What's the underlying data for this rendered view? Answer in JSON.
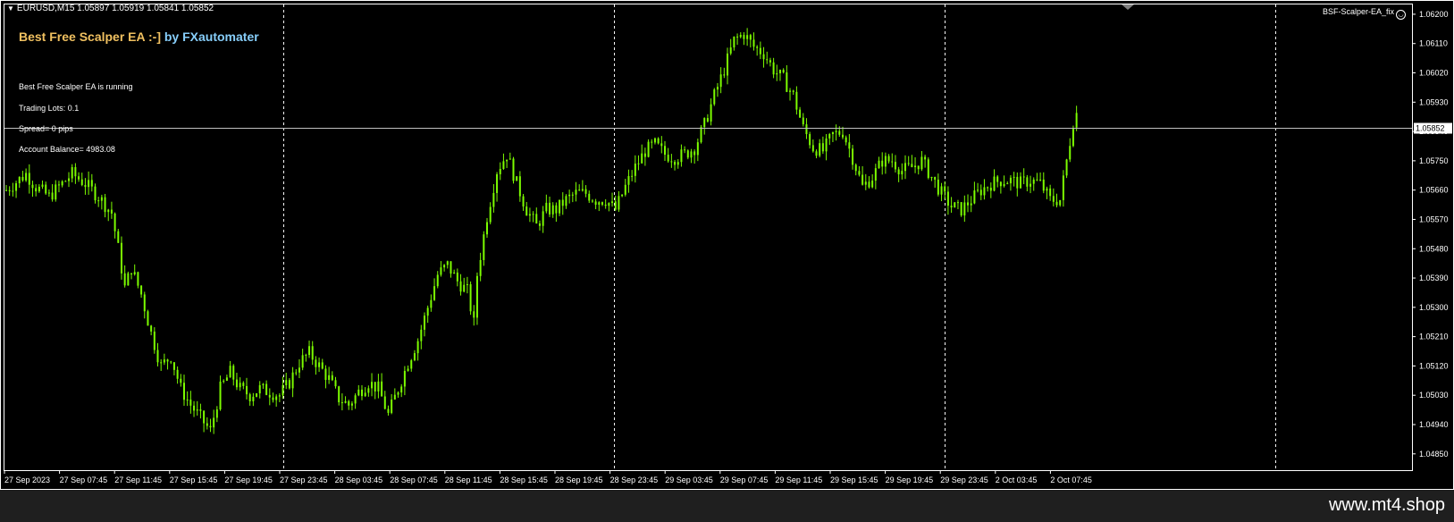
{
  "header": {
    "symbol_info": "EURUSD,M15  1.05897 1.05919 1.05841 1.05852",
    "ea_name": "BSF-Scalper-EA_fix"
  },
  "panel": {
    "title_part1": "Best Free Scalper EA :-]",
    "title_part2": " by FXautomater",
    "status": "Best Free Scalper EA is running",
    "lots": "Trading Lots:  0.1",
    "spread": "Spread= 0 pips",
    "balance": "Account Balance= 4983.08"
  },
  "footer": {
    "brand": "www.mt4.shop"
  },
  "colors": {
    "background": "#000000",
    "candle": "#7cfc00",
    "axis": "#ffffff",
    "grid": "#ffffff",
    "price_line": "#c0c0c0",
    "ea_title_a": "#f0c060",
    "ea_title_b": "#87cefa"
  },
  "chart_data": {
    "type": "candlestick",
    "symbol": "EURUSD",
    "timeframe": "M15",
    "ohlc_last": {
      "open": 1.05897,
      "high": 1.05919,
      "low": 1.05841,
      "close": 1.05852
    },
    "current_price": "1.05852",
    "ylim": [
      1.048,
      1.0623
    ],
    "y_ticks": [
      "1.06200",
      "1.06110",
      "1.06020",
      "1.05930",
      "1.05840",
      "1.05750",
      "1.05660",
      "1.05570",
      "1.05480",
      "1.05390",
      "1.05300",
      "1.05210",
      "1.05120",
      "1.05030",
      "1.04940",
      "1.04850"
    ],
    "x_ticks": [
      "27 Sep 2023",
      "27 Sep 07:45",
      "27 Sep 11:45",
      "27 Sep 15:45",
      "27 Sep 19:45",
      "27 Sep 23:45",
      "28 Sep 03:45",
      "28 Sep 07:45",
      "28 Sep 11:45",
      "28 Sep 15:45",
      "28 Sep 19:45",
      "28 Sep 23:45",
      "29 Sep 03:45",
      "29 Sep 07:45",
      "29 Sep 11:45",
      "29 Sep 15:45",
      "29 Sep 19:45",
      "29 Sep 23:45",
      "2 Oct 03:45",
      "2 Oct 07:45"
    ],
    "grid": "vertical day separators (dashed)",
    "close_path": [
      [
        0,
        1.0566
      ],
      [
        6,
        1.0571
      ],
      [
        9,
        1.0567
      ],
      [
        13,
        1.0564
      ],
      [
        17,
        1.0568
      ],
      [
        20,
        1.0571
      ],
      [
        24,
        1.0568
      ],
      [
        28,
        1.0564
      ],
      [
        32,
        1.0559
      ],
      [
        34,
        1.0548
      ],
      [
        36,
        1.0536
      ],
      [
        38,
        1.0542
      ],
      [
        41,
        1.0534
      ],
      [
        44,
        1.0522
      ],
      [
        47,
        1.0512
      ],
      [
        50,
        1.0515
      ],
      [
        53,
        1.0505
      ],
      [
        56,
        1.05
      ],
      [
        59,
        1.0496
      ],
      [
        62,
        1.0492
      ],
      [
        65,
        1.0505
      ],
      [
        68,
        1.051
      ],
      [
        71,
        1.0505
      ],
      [
        74,
        1.0503
      ],
      [
        77,
        1.0505
      ],
      [
        80,
        1.0504
      ],
      [
        83,
        1.0503
      ],
      [
        86,
        1.0507
      ],
      [
        89,
        1.0513
      ],
      [
        92,
        1.0516
      ],
      [
        95,
        1.0512
      ],
      [
        98,
        1.0508
      ],
      [
        101,
        1.0502
      ],
      [
        104,
        1.05
      ],
      [
        107,
        1.0504
      ],
      [
        110,
        1.0507
      ],
      [
        113,
        1.0505
      ],
      [
        116,
        1.0497
      ],
      [
        119,
        1.0505
      ],
      [
        122,
        1.0513
      ],
      [
        125,
        1.052
      ],
      [
        128,
        1.053
      ],
      [
        131,
        1.054
      ],
      [
        134,
        1.0543
      ],
      [
        137,
        1.0538
      ],
      [
        140,
        1.0535
      ],
      [
        142,
        1.0525
      ],
      [
        143,
        1.054
      ],
      [
        146,
        1.0558
      ],
      [
        149,
        1.0572
      ],
      [
        152,
        1.0577
      ],
      [
        155,
        1.0568
      ],
      [
        158,
        1.056
      ],
      [
        161,
        1.0555
      ],
      [
        164,
        1.056
      ],
      [
        167,
        1.056
      ],
      [
        170,
        1.0563
      ],
      [
        173,
        1.0565
      ],
      [
        176,
        1.0565
      ],
      [
        179,
        1.0563
      ],
      [
        182,
        1.0563
      ],
      [
        185,
        1.056
      ],
      [
        188,
        1.0567
      ],
      [
        191,
        1.0573
      ],
      [
        194,
        1.0578
      ],
      [
        197,
        1.058
      ],
      [
        200,
        1.0577
      ],
      [
        203,
        1.0576
      ],
      [
        206,
        1.0577
      ],
      [
        209,
        1.0579
      ],
      [
        212,
        1.0586
      ],
      [
        215,
        1.0595
      ],
      [
        218,
        1.0603
      ],
      [
        221,
        1.0612
      ],
      [
        224,
        1.0614
      ],
      [
        227,
        1.061
      ],
      [
        230,
        1.0608
      ],
      [
        233,
        1.0603
      ],
      [
        236,
        1.06
      ],
      [
        239,
        1.0595
      ],
      [
        242,
        1.0585
      ],
      [
        245,
        1.0579
      ],
      [
        248,
        1.0578
      ],
      [
        251,
        1.0583
      ],
      [
        254,
        1.0584
      ],
      [
        257,
        1.0576
      ],
      [
        260,
        1.0567
      ],
      [
        263,
        1.057
      ],
      [
        266,
        1.0575
      ],
      [
        269,
        1.0575
      ],
      [
        272,
        1.0572
      ],
      [
        275,
        1.0573
      ],
      [
        278,
        1.0575
      ],
      [
        281,
        1.057
      ],
      [
        284,
        1.0565
      ],
      [
        287,
        1.0561
      ],
      [
        290,
        1.056
      ],
      [
        293,
        1.0563
      ],
      [
        296,
        1.0566
      ],
      [
        299,
        1.0568
      ],
      [
        302,
        1.0569
      ],
      [
        305,
        1.0569
      ],
      [
        308,
        1.0568
      ],
      [
        311,
        1.0569
      ],
      [
        314,
        1.0568
      ],
      [
        317,
        1.0563
      ],
      [
        320,
        1.0563
      ],
      [
        322,
        1.0575
      ],
      [
        324,
        1.0587
      ],
      [
        325,
        1.0585
      ]
    ]
  }
}
